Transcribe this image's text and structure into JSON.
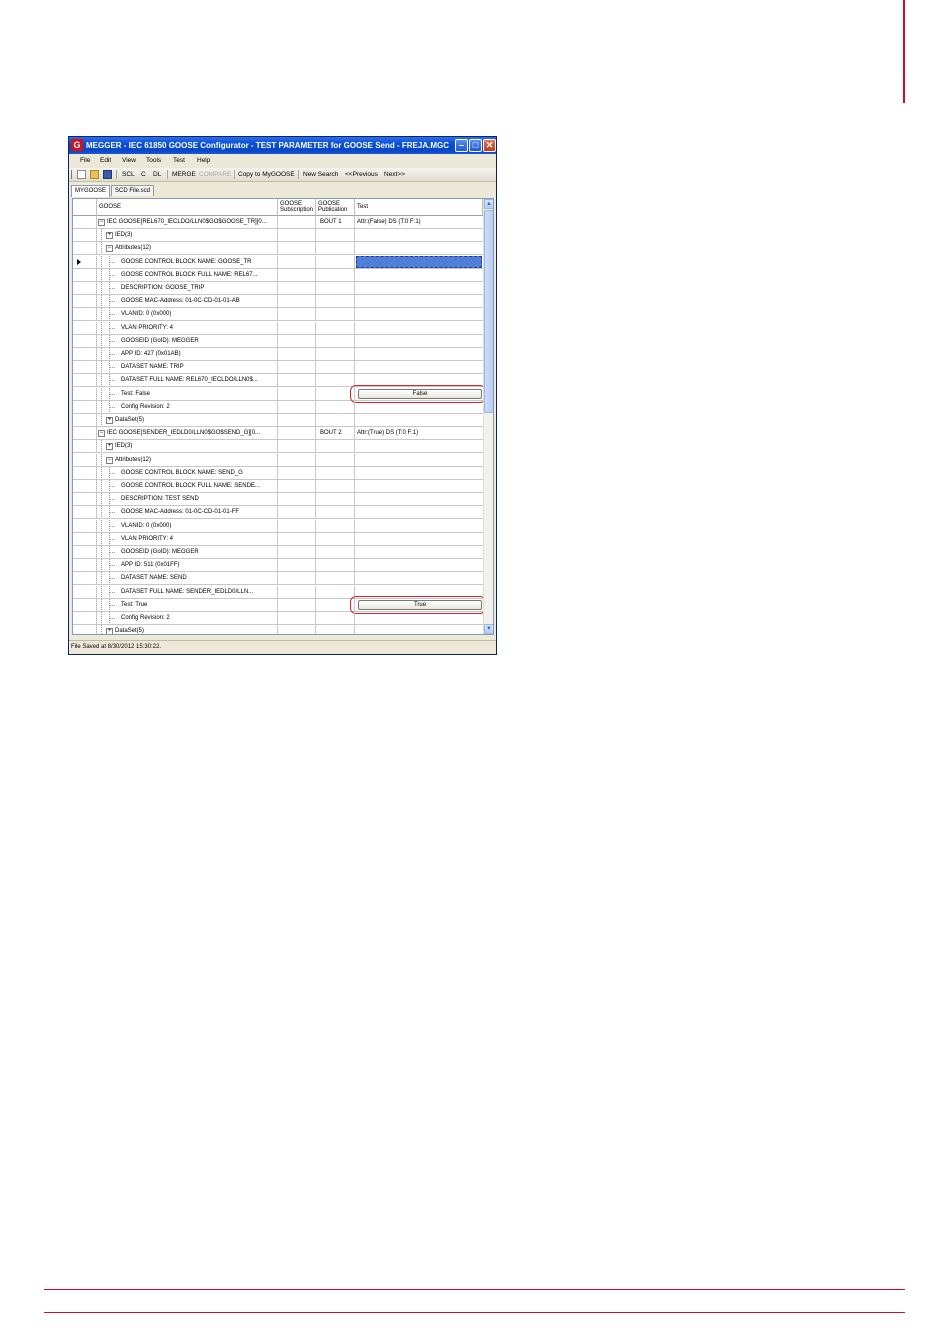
{
  "window": {
    "title": "MEGGER - IEC 61850 GOOSE Configurator - TEST PARAMETER for GOOSE Send - FREJA.MGC",
    "app_icon_letter": "G"
  },
  "menu": [
    "File",
    "Edit",
    "View",
    "Tools",
    "Test",
    "Help"
  ],
  "toolbar": {
    "items": [
      "SCL",
      "C",
      "DL",
      "MERGE",
      "COMPARE",
      "Copy to MyGOOSE",
      "New Search",
      "<<Previous",
      "Next>>"
    ],
    "disabled": [
      "COMPARE"
    ]
  },
  "tabs": [
    "MYGOOSE",
    "SCD File.scd"
  ],
  "active_tab": "MYGOOSE",
  "grid": {
    "headers": {
      "goose": "GOOSE",
      "subscription": "GOOSE\nSubscription",
      "publication": "GOOSE\nPublication",
      "test": "Test"
    },
    "rows": [
      {
        "label": "IEC GOOSE[REL670_IECLDO/LLN0$GO$GOOSE_TR][0...",
        "indent": 0,
        "toggle": "minus",
        "pub": "BOUT 1",
        "test": "Attr:(False) DS (T:0 F:1)"
      },
      {
        "label": "IED(3)",
        "indent": 1,
        "toggle": "plus"
      },
      {
        "label": "Attributes(12)",
        "indent": 1,
        "toggle": "minus"
      },
      {
        "label": "GOOSE CONTROL BLOCK NAME: GOOSE_TR",
        "indent": 2,
        "selected": true
      },
      {
        "label": "GOOSE CONTROL BLOCK FULL NAME: REL67...",
        "indent": 2
      },
      {
        "label": "DESCRIPTION: GOOSE_TRIP",
        "indent": 2
      },
      {
        "label": "GOOSE MAC-Address: 01-0C-CD-01-01-AB",
        "indent": 2
      },
      {
        "label": "VLANID: 0 (0x000)",
        "indent": 2
      },
      {
        "label": "VLAN PRIORITY: 4",
        "indent": 2
      },
      {
        "label": "GOOSEID (GoID): MEGGER",
        "indent": 2
      },
      {
        "label": "APP ID: 427 (0x01AB)",
        "indent": 2
      },
      {
        "label": "DATASET NAME: TRIP",
        "indent": 2
      },
      {
        "label": "DATASET FULL NAME: REL670_IECLDO/LLN0$...",
        "indent": 2
      },
      {
        "label": "Test: False",
        "indent": 2,
        "button": "False"
      },
      {
        "label": "Config Revision: 2",
        "indent": 2
      },
      {
        "label": "DataSet(5)",
        "indent": 1,
        "toggle": "plus"
      },
      {
        "label": "IEC GOOSE[SENDER_IEDLD0/LLN0$GO$SEND_G][0...",
        "indent": 0,
        "toggle": "minus",
        "pub": "BOUT 2",
        "test": "Attr:(True) DS (T:0 F:1)"
      },
      {
        "label": "IED(3)",
        "indent": 1,
        "toggle": "plus"
      },
      {
        "label": "Attributes(12)",
        "indent": 1,
        "toggle": "minus"
      },
      {
        "label": "GOOSE CONTROL BLOCK NAME: SEND_G",
        "indent": 2
      },
      {
        "label": "GOOSE CONTROL BLOCK FULL NAME: SENDE...",
        "indent": 2
      },
      {
        "label": "DESCRIPTION: TEST SEND",
        "indent": 2
      },
      {
        "label": "GOOSE MAC-Address: 01-0C-CD-01-01-FF",
        "indent": 2
      },
      {
        "label": "VLANID: 0 (0x000)",
        "indent": 2
      },
      {
        "label": "VLAN PRIORITY: 4",
        "indent": 2
      },
      {
        "label": "GOOSEID (GoID): MEGGER",
        "indent": 2
      },
      {
        "label": "APP ID: 511 (0x01FF)",
        "indent": 2
      },
      {
        "label": "DATASET NAME: SEND",
        "indent": 2
      },
      {
        "label": "DATASET FULL NAME: SENDER_IEDLD0/LLN...",
        "indent": 2
      },
      {
        "label": "Test: True",
        "indent": 2,
        "button": "True"
      },
      {
        "label": "Config Revision: 2",
        "indent": 2
      },
      {
        "label": "DataSet(5)",
        "indent": 1,
        "toggle": "plus"
      }
    ]
  },
  "status": "File Saved at 8/30/2012 15:30:22.",
  "colors": {
    "accent_rule": "#c8102e",
    "highlight_ring": "#d6252e",
    "selection": "#4f7fd8",
    "titlebar": "#0a4fd4"
  }
}
